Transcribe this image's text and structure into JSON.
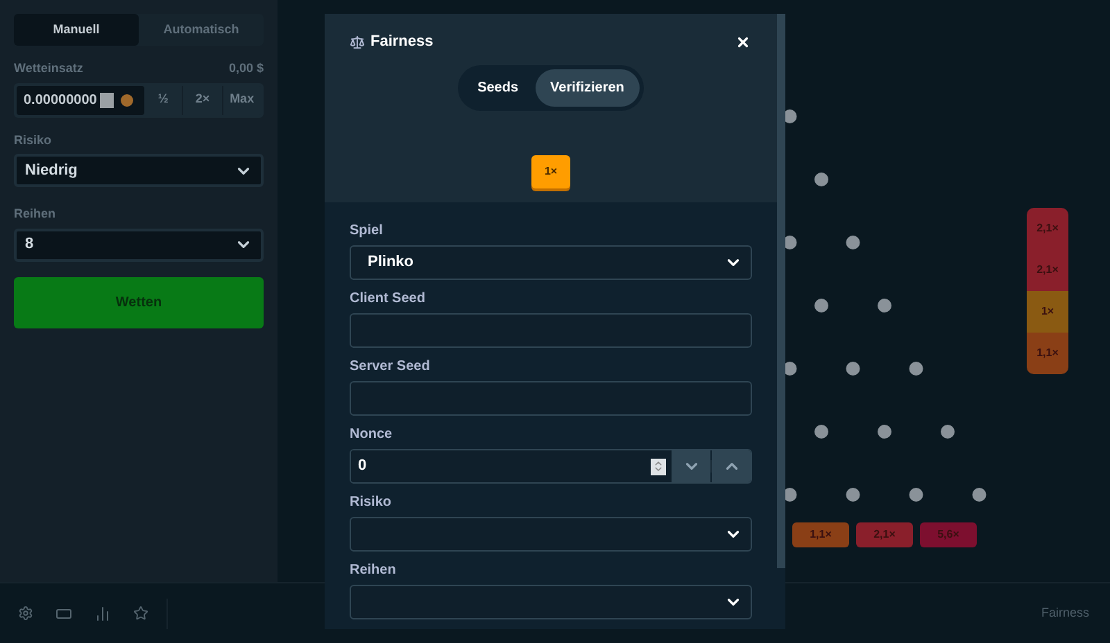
{
  "sidebar": {
    "mode_tabs": [
      {
        "label": "Manuell",
        "selected": true
      },
      {
        "label": "Automatisch",
        "selected": false
      }
    ],
    "bet_amount": {
      "label": "Wetteinsatz",
      "balance": "0,00 $",
      "value": "0.00000000",
      "buttons": [
        "½",
        "2×",
        "Max"
      ]
    },
    "risk": {
      "label": "Risiko",
      "value": "Niedrig"
    },
    "rows": {
      "label": "Reihen",
      "value": "8"
    },
    "bet_button": "Wetten"
  },
  "board": {
    "multipliers": [
      {
        "label": "1,1×",
        "color": "#8a3f16"
      },
      {
        "label": "2,1×",
        "color": "#8a1f2b"
      },
      {
        "label": "5,6×",
        "color": "#7d0f2f"
      }
    ],
    "history": [
      {
        "label": "2,1×",
        "color": "#8a1f2b"
      },
      {
        "label": "2,1×",
        "color": "#8a1f2b"
      },
      {
        "label": "1×",
        "color": "#8a5a12"
      },
      {
        "label": "1,1×",
        "color": "#8a3f16"
      }
    ]
  },
  "bottom_bar": {
    "fairness_link": "Fairness"
  },
  "modal": {
    "title": "Fairness",
    "tabs": [
      {
        "label": "Seeds",
        "selected": false
      },
      {
        "label": "Verifizieren",
        "selected": true
      }
    ],
    "result_badge": "1×",
    "fields": [
      {
        "kind": "select",
        "label": "Spiel",
        "value": "Plinko"
      },
      {
        "kind": "text",
        "label": "Client Seed"
      },
      {
        "kind": "text",
        "label": "Server Seed"
      },
      {
        "kind": "number",
        "label": "Nonce",
        "value": "0"
      },
      {
        "kind": "select",
        "label": "Risiko"
      },
      {
        "kind": "select",
        "label": "Reihen"
      }
    ]
  }
}
